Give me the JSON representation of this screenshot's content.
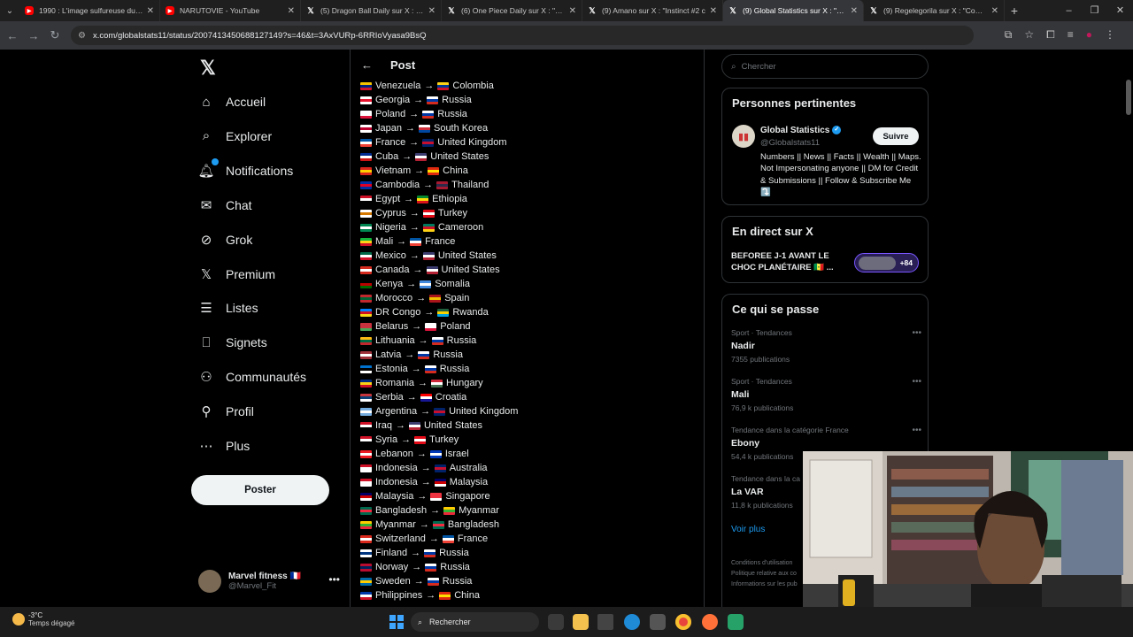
{
  "browser": {
    "tabs": [
      {
        "title": "1990 : L'image sulfureuse du rap",
        "favicon": "youtube-icon",
        "active": false
      },
      {
        "title": "NARUTOVIE - YouTube",
        "favicon": "youtube-icon",
        "active": false
      },
      {
        "title": "(5) Dragon Ball Daily sur X : \"Ve",
        "favicon": "x-icon",
        "active": false
      },
      {
        "title": "(6) One Piece Daily sur X : \"Rou",
        "favicon": "x-icon",
        "active": false
      },
      {
        "title": "(9) Amano sur X : \"Instinct #2 c",
        "favicon": "x-icon",
        "active": false
      },
      {
        "title": "(9) Global Statistics sur X : \"Cou",
        "favicon": "x-icon",
        "active": true
      },
      {
        "title": "(9) Regelegorila sur X : \"Comm",
        "favicon": "x-icon",
        "active": false
      }
    ],
    "url": "x.com/globalstats11/status/2007413450688127149?s=46&t=3AxVURp-6RRIoVyasa9BsQ"
  },
  "left_nav": {
    "logo": "𝕏",
    "items": [
      {
        "label": "Accueil",
        "icon": "home-icon"
      },
      {
        "label": "Explorer",
        "icon": "search-icon"
      },
      {
        "label": "Notifications",
        "icon": "bell-icon"
      },
      {
        "label": "Chat",
        "icon": "mail-icon"
      },
      {
        "label": "Grok",
        "icon": "grok-icon"
      },
      {
        "label": "Premium",
        "icon": "x-premium-icon"
      },
      {
        "label": "Listes",
        "icon": "list-icon"
      },
      {
        "label": "Signets",
        "icon": "bookmark-icon"
      },
      {
        "label": "Communautés",
        "icon": "communities-icon"
      },
      {
        "label": "Profil",
        "icon": "person-icon"
      },
      {
        "label": "Plus",
        "icon": "more-circle-icon"
      }
    ],
    "post_button": "Poster",
    "account": {
      "name": "Marvel fitness 🇫🇷",
      "handle": "@Marvel_Fit"
    }
  },
  "main": {
    "header_title": "Post",
    "pairs": [
      {
        "from": "Venezuela",
        "to": "Colombia",
        "from_flag": [
          "#f4c400",
          "#00247d",
          "#cf142b"
        ],
        "to_flag": [
          "#fcd116",
          "#003893",
          "#ce1126"
        ]
      },
      {
        "from": "Georgia",
        "to": "Russia",
        "from_flag": [
          "#ffffff",
          "#e8112d",
          "#ffffff"
        ],
        "to_flag": [
          "#ffffff",
          "#0039a6",
          "#d52b1e"
        ]
      },
      {
        "from": "Poland",
        "to": "Russia",
        "from_flag": [
          "#ffffff",
          "#ffffff",
          "#dc143c"
        ],
        "to_flag": [
          "#ffffff",
          "#0039a6",
          "#d52b1e"
        ]
      },
      {
        "from": "Japan",
        "to": "South Korea",
        "from_flag": [
          "#ffffff",
          "#bc002d",
          "#ffffff"
        ],
        "to_flag": [
          "#ffffff",
          "#cd2e3a",
          "#0047a0"
        ]
      },
      {
        "from": "France",
        "to": "United Kingdom",
        "from_flag": [
          "#0055a4",
          "#ffffff",
          "#ef4135"
        ],
        "to_flag": [
          "#012169",
          "#c8102e",
          "#012169"
        ]
      },
      {
        "from": "Cuba",
        "to": "United States",
        "from_flag": [
          "#002a8f",
          "#ffffff",
          "#cb1515"
        ],
        "to_flag": [
          "#3c3b6e",
          "#ffffff",
          "#b22234"
        ]
      },
      {
        "from": "Vietnam",
        "to": "China",
        "from_flag": [
          "#da251d",
          "#ffcd00",
          "#da251d"
        ],
        "to_flag": [
          "#de2910",
          "#ffde00",
          "#de2910"
        ]
      },
      {
        "from": "Cambodia",
        "to": "Thailand",
        "from_flag": [
          "#032ea1",
          "#e00025",
          "#032ea1"
        ],
        "to_flag": [
          "#a51931",
          "#2d2a4a",
          "#a51931"
        ]
      },
      {
        "from": "Egypt",
        "to": "Ethiopia",
        "from_flag": [
          "#ce1126",
          "#ffffff",
          "#000000"
        ],
        "to_flag": [
          "#078930",
          "#fcdd09",
          "#da121a"
        ]
      },
      {
        "from": "Cyprus",
        "to": "Turkey",
        "from_flag": [
          "#ffffff",
          "#d57800",
          "#ffffff"
        ],
        "to_flag": [
          "#e30a17",
          "#ffffff",
          "#e30a17"
        ]
      },
      {
        "from": "Nigeria",
        "to": "Cameroon",
        "from_flag": [
          "#008751",
          "#ffffff",
          "#008751"
        ],
        "to_flag": [
          "#007a5e",
          "#ce1126",
          "#fcd116"
        ]
      },
      {
        "from": "Mali",
        "to": "France",
        "from_flag": [
          "#14b53a",
          "#fcd116",
          "#ce1126"
        ],
        "to_flag": [
          "#0055a4",
          "#ffffff",
          "#ef4135"
        ]
      },
      {
        "from": "Mexico",
        "to": "United States",
        "from_flag": [
          "#006847",
          "#ffffff",
          "#ce1126"
        ],
        "to_flag": [
          "#3c3b6e",
          "#ffffff",
          "#b22234"
        ]
      },
      {
        "from": "Canada",
        "to": "United States",
        "from_flag": [
          "#d52b1e",
          "#ffffff",
          "#d52b1e"
        ],
        "to_flag": [
          "#3c3b6e",
          "#ffffff",
          "#b22234"
        ]
      },
      {
        "from": "Kenya",
        "to": "Somalia",
        "from_flag": [
          "#000000",
          "#bb0000",
          "#006600"
        ],
        "to_flag": [
          "#4189dd",
          "#ffffff",
          "#4189dd"
        ]
      },
      {
        "from": "Morocco",
        "to": "Spain",
        "from_flag": [
          "#c1272d",
          "#006233",
          "#c1272d"
        ],
        "to_flag": [
          "#aa151b",
          "#f1bf00",
          "#aa151b"
        ]
      },
      {
        "from": "DR Congo",
        "to": "Rwanda",
        "from_flag": [
          "#007fff",
          "#ce1021",
          "#f7d618"
        ],
        "to_flag": [
          "#20603d",
          "#fad201",
          "#00a1de"
        ]
      },
      {
        "from": "Belarus",
        "to": "Poland",
        "from_flag": [
          "#c8313e",
          "#c8313e",
          "#4aa657"
        ],
        "to_flag": [
          "#ffffff",
          "#ffffff",
          "#dc143c"
        ]
      },
      {
        "from": "Lithuania",
        "to": "Russia",
        "from_flag": [
          "#fdb913",
          "#006a44",
          "#c1272d"
        ],
        "to_flag": [
          "#ffffff",
          "#0039a6",
          "#d52b1e"
        ]
      },
      {
        "from": "Latvia",
        "to": "Russia",
        "from_flag": [
          "#9e3039",
          "#ffffff",
          "#9e3039"
        ],
        "to_flag": [
          "#ffffff",
          "#0039a6",
          "#d52b1e"
        ]
      },
      {
        "from": "Estonia",
        "to": "Russia",
        "from_flag": [
          "#0072ce",
          "#000000",
          "#ffffff"
        ],
        "to_flag": [
          "#ffffff",
          "#0039a6",
          "#d52b1e"
        ]
      },
      {
        "from": "Romania",
        "to": "Hungary",
        "from_flag": [
          "#002b7f",
          "#fcd116",
          "#ce1126"
        ],
        "to_flag": [
          "#ce2939",
          "#ffffff",
          "#477050"
        ]
      },
      {
        "from": "Serbia",
        "to": "Croatia",
        "from_flag": [
          "#c6363c",
          "#0c4076",
          "#ffffff"
        ],
        "to_flag": [
          "#ff0000",
          "#ffffff",
          "#171796"
        ]
      },
      {
        "from": "Argentina",
        "to": "United Kingdom",
        "from_flag": [
          "#74acdf",
          "#ffffff",
          "#74acdf"
        ],
        "to_flag": [
          "#012169",
          "#c8102e",
          "#012169"
        ]
      },
      {
        "from": "Iraq",
        "to": "United States",
        "from_flag": [
          "#ce1126",
          "#ffffff",
          "#000000"
        ],
        "to_flag": [
          "#3c3b6e",
          "#ffffff",
          "#b22234"
        ]
      },
      {
        "from": "Syria",
        "to": "Turkey",
        "from_flag": [
          "#ce1126",
          "#ffffff",
          "#000000"
        ],
        "to_flag": [
          "#e30a17",
          "#ffffff",
          "#e30a17"
        ]
      },
      {
        "from": "Lebanon",
        "to": "Israel",
        "from_flag": [
          "#ed1c24",
          "#ffffff",
          "#ed1c24"
        ],
        "to_flag": [
          "#0038b8",
          "#ffffff",
          "#0038b8"
        ]
      },
      {
        "from": "Indonesia",
        "to": "Australia",
        "from_flag": [
          "#ce1126",
          "#ffffff",
          "#ffffff"
        ],
        "to_flag": [
          "#012169",
          "#c8102e",
          "#012169"
        ]
      },
      {
        "from": "Indonesia",
        "to": "Malaysia",
        "from_flag": [
          "#ce1126",
          "#ffffff",
          "#ffffff"
        ],
        "to_flag": [
          "#010066",
          "#cc0001",
          "#ffffff"
        ]
      },
      {
        "from": "Malaysia",
        "to": "Singapore",
        "from_flag": [
          "#010066",
          "#cc0001",
          "#ffffff"
        ],
        "to_flag": [
          "#ef3340",
          "#ef3340",
          "#ffffff"
        ]
      },
      {
        "from": "Bangladesh",
        "to": "Myanmar",
        "from_flag": [
          "#006a4e",
          "#f42a41",
          "#006a4e"
        ],
        "to_flag": [
          "#fecb00",
          "#34b233",
          "#ea2839"
        ]
      },
      {
        "from": "Myanmar",
        "to": "Bangladesh",
        "from_flag": [
          "#fecb00",
          "#34b233",
          "#ea2839"
        ],
        "to_flag": [
          "#006a4e",
          "#f42a41",
          "#006a4e"
        ]
      },
      {
        "from": "Switzerland",
        "to": "France",
        "from_flag": [
          "#da291c",
          "#ffffff",
          "#da291c"
        ],
        "to_flag": [
          "#0055a4",
          "#ffffff",
          "#ef4135"
        ]
      },
      {
        "from": "Finland",
        "to": "Russia",
        "from_flag": [
          "#ffffff",
          "#003580",
          "#ffffff"
        ],
        "to_flag": [
          "#ffffff",
          "#0039a6",
          "#d52b1e"
        ]
      },
      {
        "from": "Norway",
        "to": "Russia",
        "from_flag": [
          "#ba0c2f",
          "#00205b",
          "#ba0c2f"
        ],
        "to_flag": [
          "#ffffff",
          "#0039a6",
          "#d52b1e"
        ]
      },
      {
        "from": "Sweden",
        "to": "Russia",
        "from_flag": [
          "#006aa7",
          "#fecc00",
          "#006aa7"
        ],
        "to_flag": [
          "#ffffff",
          "#0039a6",
          "#d52b1e"
        ]
      },
      {
        "from": "Philippines",
        "to": "China",
        "from_flag": [
          "#0038a8",
          "#ffffff",
          "#ce1126"
        ],
        "to_flag": [
          "#de2910",
          "#ffde00",
          "#de2910"
        ]
      }
    ]
  },
  "right": {
    "search_placeholder": "Chercher",
    "relevant": {
      "title": "Personnes pertinentes",
      "name": "Global Statistics",
      "handle": "@Globalstats11",
      "follow": "Suivre",
      "bio": "Numbers || News || Facts || Wealth || Maps. Not Impersonating anyone || DM for Credit & Submissions || Follow & Subscribe Me ⤵️"
    },
    "live": {
      "title": "En direct sur X",
      "headline": "BEFOREE J-1 AVANT LE CHOC PLANÉTAIRE 🇸🇳 ...",
      "count": "+84"
    },
    "trending": {
      "title": "Ce qui se passe",
      "items": [
        {
          "context": "Sport · Tendances",
          "name": "Nadir",
          "count": "7355 publications"
        },
        {
          "context": "Sport · Tendances",
          "name": "Mali",
          "count": "76,9 k publications"
        },
        {
          "context": "Tendance dans la catégorie France",
          "name": "Ebony",
          "count": "54,4 k publications"
        },
        {
          "context": "Tendance dans la ca",
          "name": "La VAR",
          "count": "11,8 k publications"
        }
      ],
      "more": "Voir plus"
    },
    "footer": [
      "Conditions d'utilisation",
      "Politique relative aux co",
      "Informations sur les pub"
    ]
  },
  "taskbar": {
    "temp": "-3°C",
    "weather": "Temps dégagé",
    "search": "Rechercher"
  }
}
